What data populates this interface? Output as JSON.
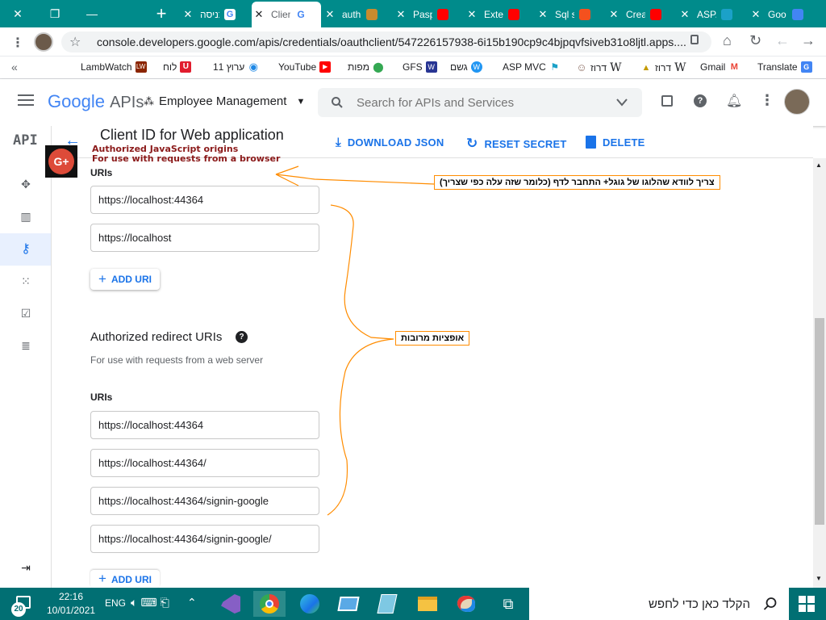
{
  "browser": {
    "tabs": [
      {
        "title": "כניסה",
        "close": "✕"
      },
      {
        "title": "Clien",
        "close": "✕"
      },
      {
        "title": "auth",
        "close": "✕"
      },
      {
        "title": "Pasp",
        "close": "✕"
      },
      {
        "title": "Exte",
        "close": "✕"
      },
      {
        "title": "Sql s",
        "close": "✕"
      },
      {
        "title": "Crea",
        "close": "✕"
      },
      {
        "title": "ASP.",
        "close": "✕"
      },
      {
        "title": "Goo",
        "close": "✕"
      }
    ],
    "new_tab": "+",
    "url": "console.developers.google.com/apis/credentials/oauthclient/547226157938-6i15b190cp9c4bjpqvfsiveb31o8ljtl.apps....",
    "bookmarks": [
      {
        "label": "LambWatch",
        "color": "#8b2500",
        "icon": "LW"
      },
      {
        "label": "לוח",
        "color": "#e11c2e",
        "icon": "U"
      },
      {
        "label": "ערוץ 11",
        "color": "#1e88e5",
        "icon": "◉"
      },
      {
        "label": "YouTube",
        "color": "#ff0000",
        "icon": "▶"
      },
      {
        "label": "מפות",
        "color": "#34a853",
        "icon": "⬤"
      },
      {
        "label": "GFS",
        "color": "#283593",
        "icon": "W"
      },
      {
        "label": "גשם",
        "color": "#2196f3",
        "icon": "W"
      },
      {
        "label": "ASP MVC",
        "color": "#1ba1c8",
        "icon": "⚑"
      },
      {
        "label": "דרוז",
        "color": "#8d6e63",
        "icon": "☺"
      },
      {
        "label": "דרוז",
        "color": "#c49a00",
        "icon": "▲"
      },
      {
        "label": "Gmail",
        "color": "#ea4335",
        "icon": "M"
      },
      {
        "label": "Translate",
        "color": "#4285f4",
        "icon": "G"
      }
    ],
    "bookmark_chevron": "«"
  },
  "gcp": {
    "logo_google": "Google",
    "logo_apis": "APIs",
    "project": "Employee Management",
    "search_placeholder": "Search for APIs and Services",
    "api_badge": "API"
  },
  "page": {
    "title": "Client ID for Web application",
    "download": "DOWNLOAD JSON",
    "reset": "RESET SECRET",
    "delete": "DELETE",
    "overlay_line1": "Authorized JavaScript origins",
    "overlay_line2": "For use with requests from a browser",
    "uris_label": "URIs",
    "js_origins": [
      "https://localhost:44364",
      "https://localhost"
    ],
    "add_uri": "ADD URI",
    "redirect_title": "Authorized redirect URIs",
    "redirect_subtitle": "For use with requests from a web server",
    "redirect_uris_label": "URIs",
    "redirect_uris": [
      "https://localhost:44364",
      "https://localhost:44364/",
      "https://localhost:44364/signin-google",
      "https://localhost:44364/signin-google/"
    ],
    "add_uri2": "ADD URI"
  },
  "annotations": {
    "note1": "צריך לוודא שהלוגו של גוגל+ התחבר לדף (כלומר שזה עלה כפי שצריך)",
    "note2": "אופציות מרובות",
    "accent": "#ff8c00"
  },
  "taskbar": {
    "time": "22:16",
    "date": "10/01/2021",
    "lang": "ENG",
    "search_text": "הקלד כאן כדי לחפש",
    "notif_count": "20"
  }
}
